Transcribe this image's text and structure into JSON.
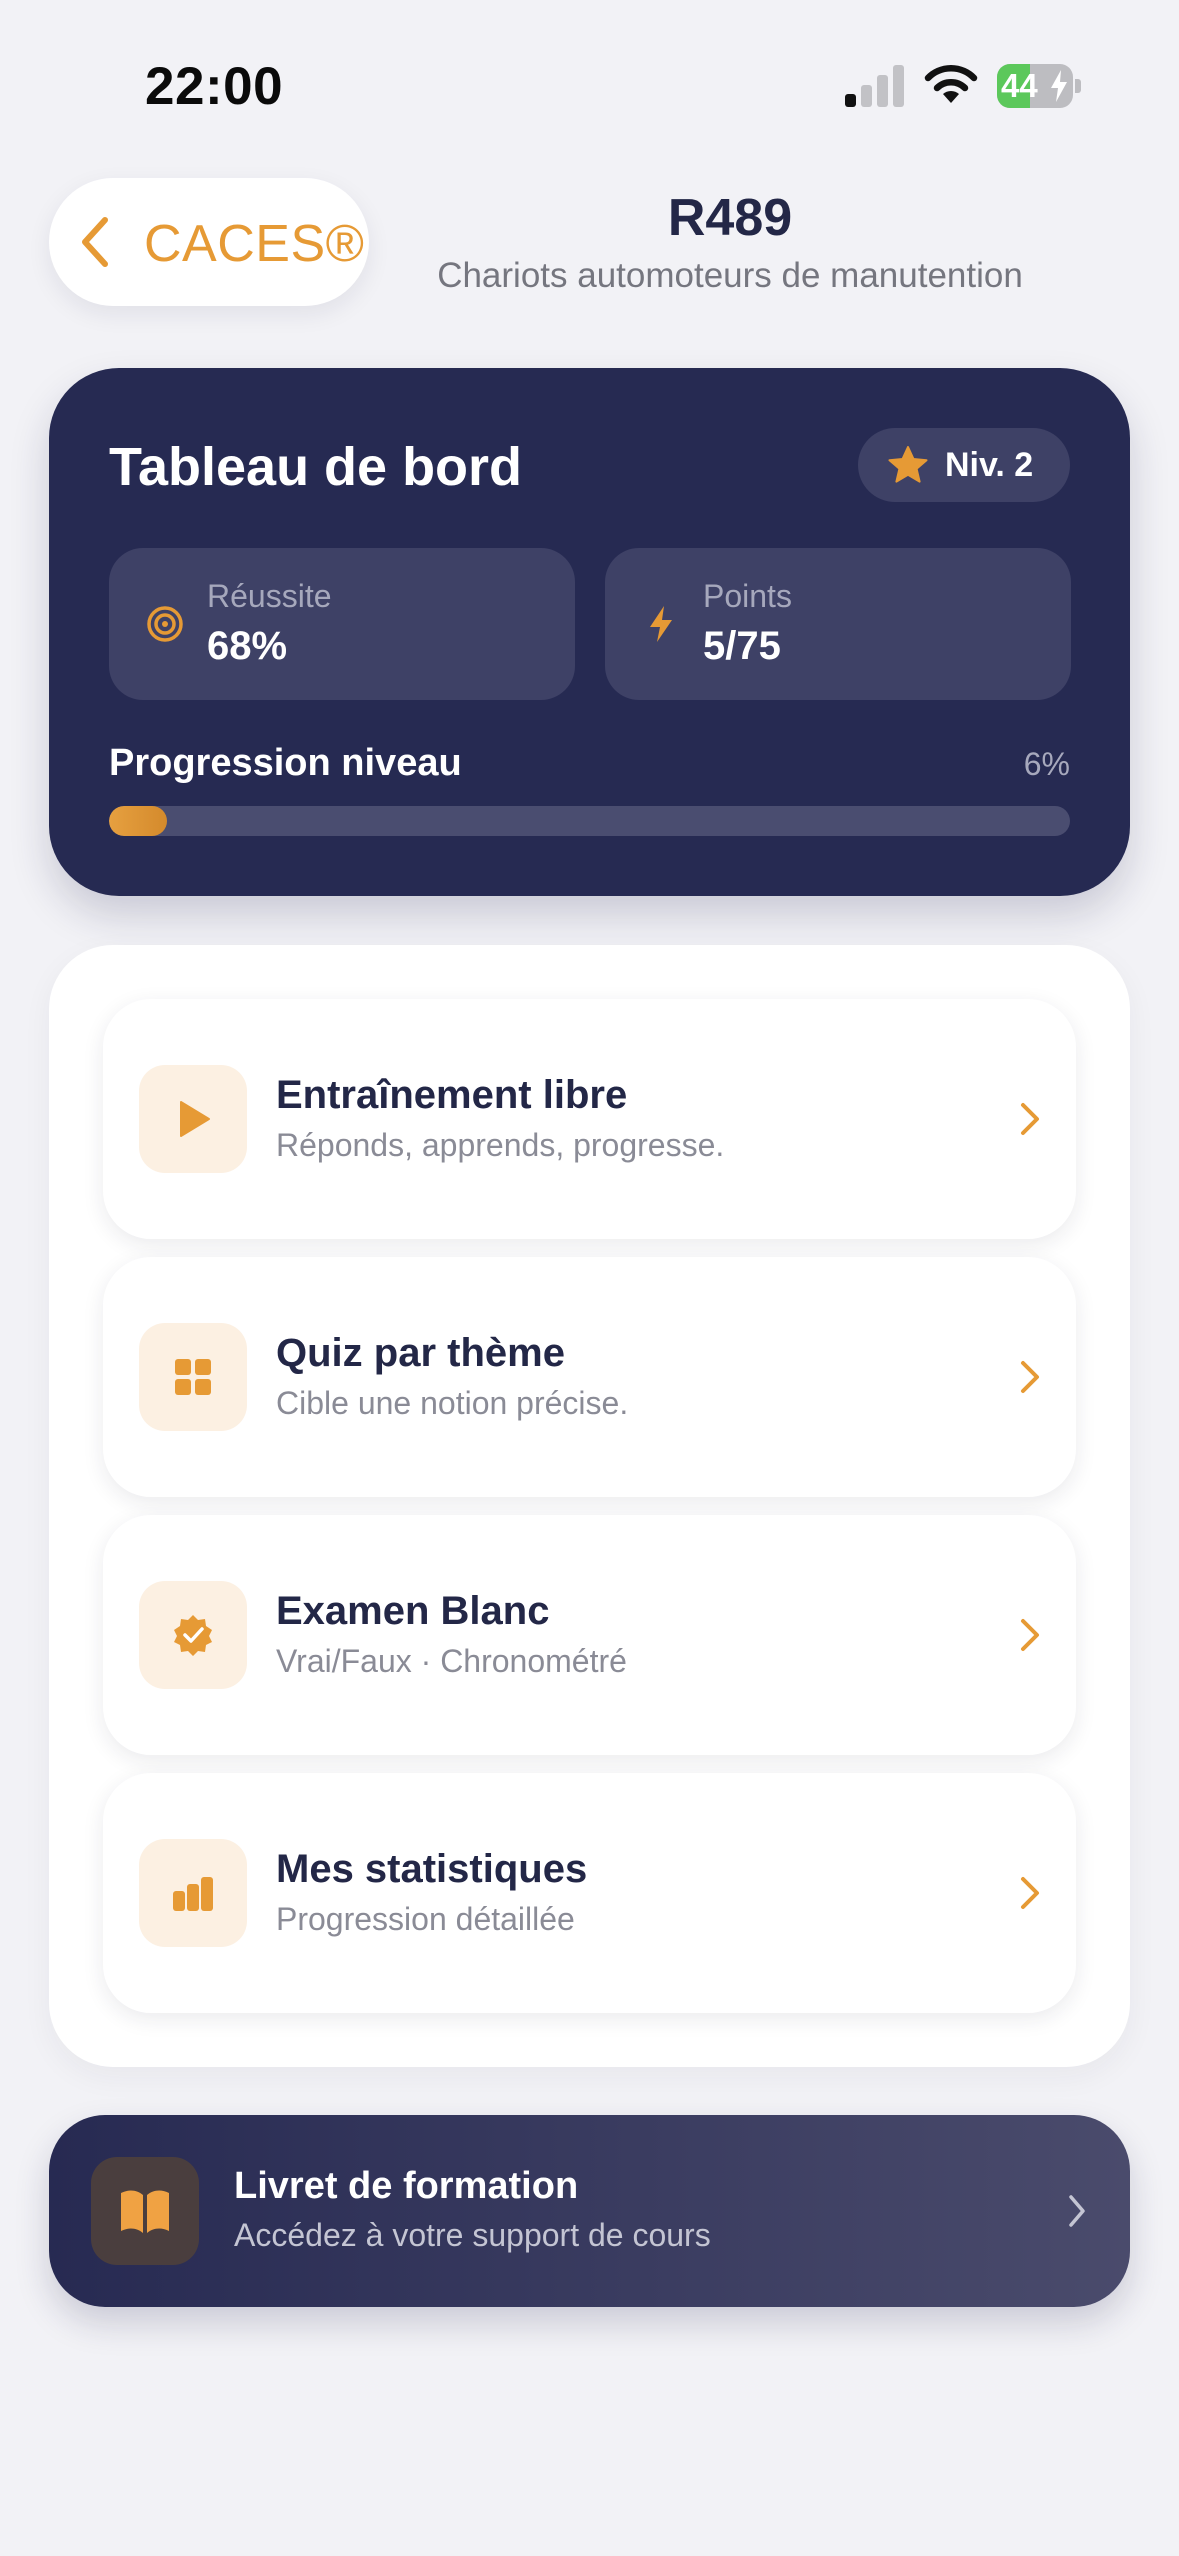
{
  "status_bar": {
    "time": "22:00",
    "battery_level": "44",
    "battery_fraction": 0.44
  },
  "header": {
    "back_label": "CACES®",
    "title": "R489",
    "subtitle": "Chariots automoteurs de manutention"
  },
  "dashboard": {
    "title": "Tableau de bord",
    "level_badge": "Niv. 2",
    "stats": [
      {
        "label": "Réussite",
        "value": "68%",
        "icon": "target-icon"
      },
      {
        "label": "Points",
        "value": "5/75",
        "icon": "bolt-icon"
      }
    ],
    "progress": {
      "label": "Progression niveau",
      "percent_text": "6%",
      "value": 0.06
    }
  },
  "menu": [
    {
      "title": "Entraînement libre",
      "subtitle": "Réponds, apprends, progresse.",
      "icon": "play-icon"
    },
    {
      "title": "Quiz par thème",
      "subtitle": "Cible une notion précise.",
      "icon": "grid-icon"
    },
    {
      "title": "Examen Blanc",
      "subtitle": "Vrai/Faux · Chronométré",
      "icon": "verified-badge-icon"
    },
    {
      "title": "Mes statistiques",
      "subtitle": "Progression détaillée",
      "icon": "bar-chart-icon"
    }
  ],
  "booklet": {
    "title": "Livret de formation",
    "subtitle": "Accédez à votre support de cours",
    "icon": "book-icon"
  },
  "colors": {
    "accent": "#e69a35",
    "navy": "#262a52",
    "background": "#f2f2f6",
    "battery_green": "#5cc85b"
  }
}
